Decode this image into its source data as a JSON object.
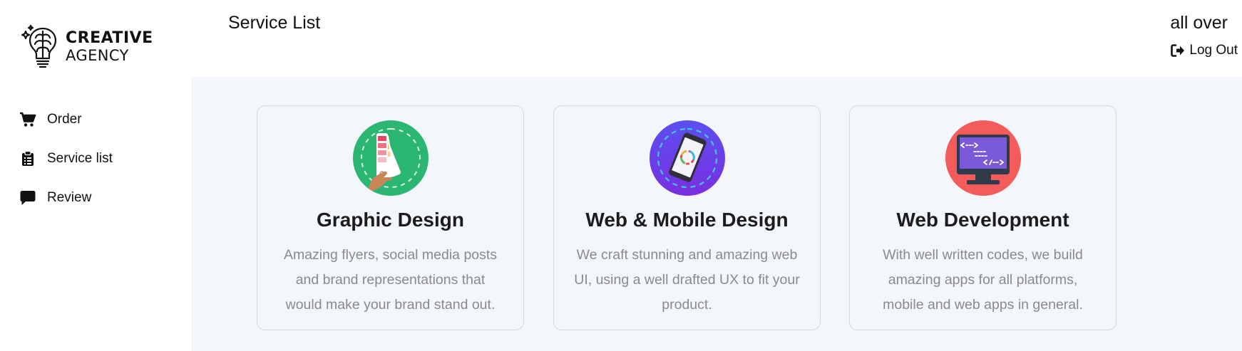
{
  "brand": {
    "line1": "CREATIVE",
    "line2": "AGENCY",
    "icon": "brain-lightbulb-icon"
  },
  "sidebar": {
    "items": [
      {
        "label": "Order",
        "icon": "cart-icon"
      },
      {
        "label": "Service list",
        "icon": "clipboard-icon"
      },
      {
        "label": "Review",
        "icon": "message-icon"
      }
    ]
  },
  "header": {
    "title": "Service List",
    "user_name": "all over",
    "logout_label": "Log Out",
    "logout_icon": "sign-out-icon"
  },
  "services": [
    {
      "title": "Graphic Design",
      "description": "Amazing flyers, social media posts and brand representations that would make your brand stand out.",
      "icon": "color-palette-icon",
      "icon_color": "#2bb673"
    },
    {
      "title": "Web & Mobile Design",
      "description": "We craft stunning and amazing web UI, using a well drafted UX to fit your product.",
      "icon": "mobile-phone-icon",
      "icon_color": "#6c3df0"
    },
    {
      "title": "Web Development",
      "description": "With well written codes, we build amazing apps for all platforms, mobile and web apps in general.",
      "icon": "code-monitor-icon",
      "icon_color": "#f45b5b"
    }
  ],
  "colors": {
    "main_background": "#f3f6fa",
    "card_border": "#d3d9df",
    "description_text": "#8a8a8a"
  }
}
